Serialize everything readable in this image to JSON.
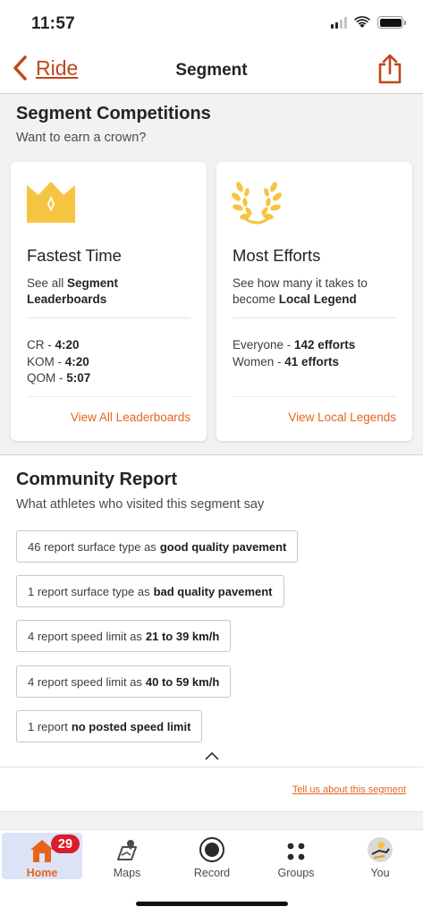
{
  "status_bar": {
    "time": "11:57"
  },
  "nav": {
    "back_label": "Ride",
    "title": "Segment"
  },
  "competitions": {
    "title": "Segment Competitions",
    "subtitle": "Want to earn a crown?",
    "fastest_time": {
      "icon": "crown-icon",
      "title": "Fastest Time",
      "desc_prefix": "See all ",
      "desc_bold": "Segment Leaderboards",
      "stats": [
        {
          "label": "CR - ",
          "value": "4:20"
        },
        {
          "label": "KOM - ",
          "value": "4:20"
        },
        {
          "label": "QOM - ",
          "value": "5:07"
        }
      ],
      "link": "View All Leaderboards"
    },
    "most_efforts": {
      "icon": "laurel-wreath-icon",
      "title": "Most Efforts",
      "desc_prefix": "See how many it takes to become ",
      "desc_bold": "Local Legend",
      "stats": [
        {
          "label": "Everyone - ",
          "value": "142 efforts"
        },
        {
          "label": "Women - ",
          "value": "41 efforts"
        }
      ],
      "link": "View Local Legends"
    }
  },
  "community": {
    "title": "Community Report",
    "subtitle": "What athletes who visited this segment say",
    "reports": [
      {
        "text": "46 report surface type as",
        "bold": "good quality pavement"
      },
      {
        "text": "1 report surface type as",
        "bold": "bad quality pavement"
      },
      {
        "text": "4 report speed limit as",
        "bold": "21 to 39 km/h"
      },
      {
        "text": "4 report speed limit as",
        "bold": "40 to 59 km/h"
      },
      {
        "text": "1 report",
        "bold": "no posted speed limit"
      }
    ],
    "tell_us": "Tell us about this segment"
  },
  "tab_bar": {
    "tabs": [
      {
        "label": "Home",
        "icon": "home-icon",
        "badge": "29",
        "active": true
      },
      {
        "label": "Maps",
        "icon": "map-icon"
      },
      {
        "label": "Record",
        "icon": "record-icon"
      },
      {
        "label": "Groups",
        "icon": "groups-icon"
      },
      {
        "label": "You",
        "icon": "avatar-icon"
      }
    ]
  },
  "colors": {
    "accent": "#e8641c",
    "nav_accent": "#c0461c",
    "badge": "#d81e2a",
    "crown": "#f5c542",
    "active_tab_bg": "#dde3f6"
  }
}
